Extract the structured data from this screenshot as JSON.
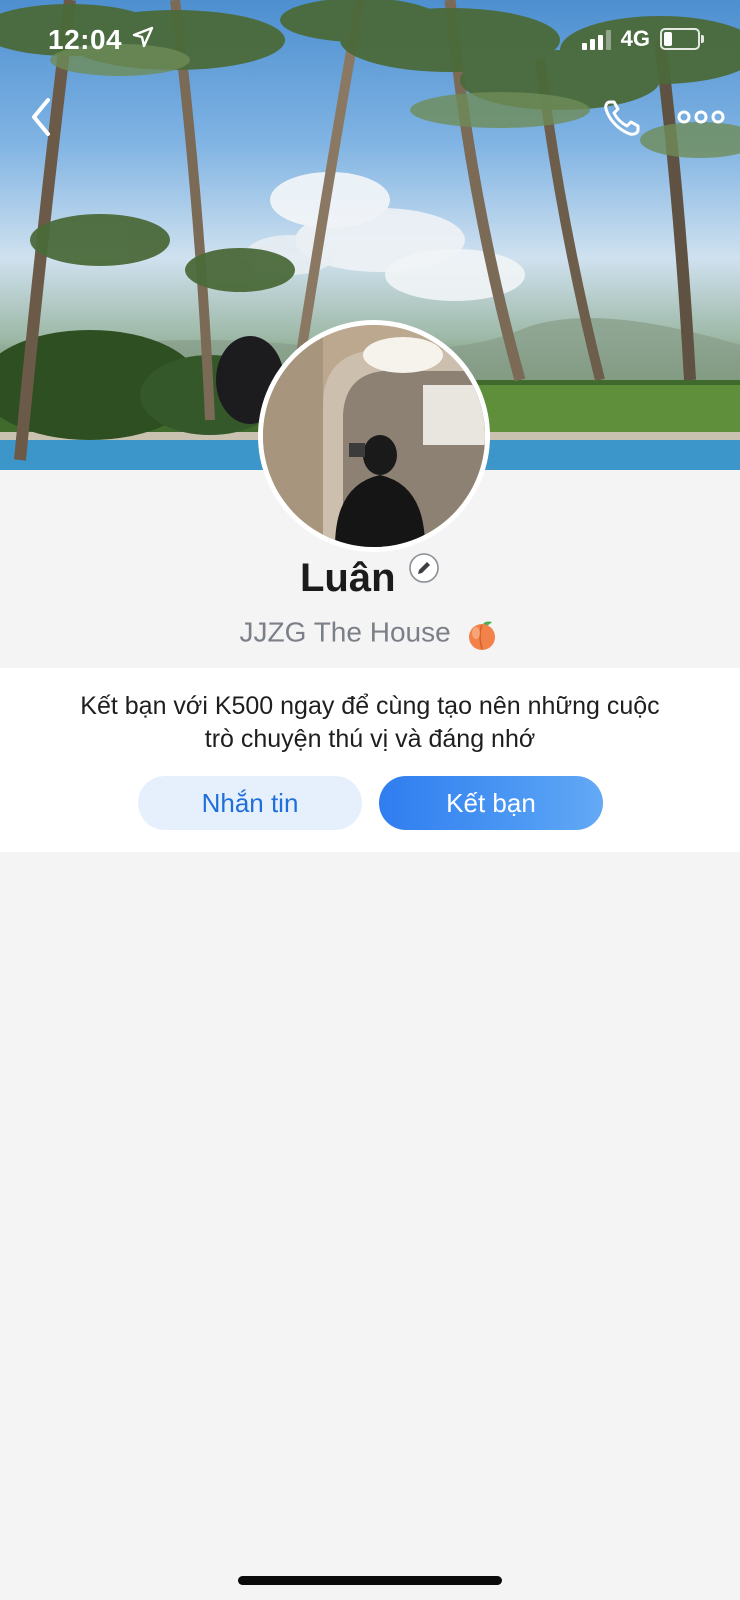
{
  "status_bar": {
    "time": "12:04",
    "network": "4G",
    "icons": [
      "location-arrow-icon",
      "signal-icon",
      "battery-icon"
    ]
  },
  "nav": {
    "icons": [
      "back-chevron-icon",
      "phone-call-icon",
      "more-dots-icon"
    ]
  },
  "profile": {
    "name": "Luân",
    "bio": "JJZG The House",
    "bio_emoji": "peach-icon",
    "edit_icon": "edit-pencil-icon"
  },
  "friend_prompt": {
    "line1": "Kết bạn với K500 ngay để cùng tạo nên những cuộc",
    "line2": "trò chuyện thú vị và đáng nhớ",
    "message_button": "Nhắn tin",
    "add_friend_button": "Kết bạn"
  },
  "colors": {
    "primary_blue": "#2f7df0",
    "secondary_button_bg": "#e6f0fd",
    "page_bg": "#f4f4f5"
  }
}
